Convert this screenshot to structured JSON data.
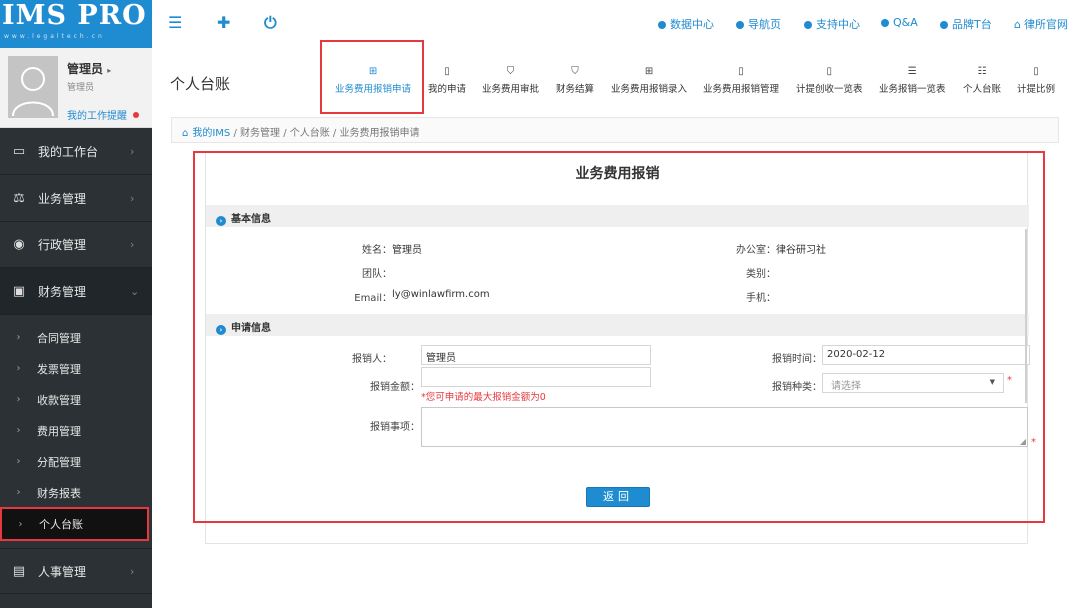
{
  "brand": {
    "logo": "IMS PRO",
    "logo_sub": "www.legaltech.cn"
  },
  "user": {
    "name": "管理员",
    "role": "管理员",
    "notice": "我的工作提醒"
  },
  "sidebar": {
    "items": [
      {
        "label": "我的工作台"
      },
      {
        "label": "业务管理"
      },
      {
        "label": "行政管理"
      },
      {
        "label": "财务管理"
      }
    ],
    "submenu": [
      {
        "label": "合同管理"
      },
      {
        "label": "发票管理"
      },
      {
        "label": "收款管理"
      },
      {
        "label": "费用管理"
      },
      {
        "label": "分配管理"
      },
      {
        "label": "财务报表"
      },
      {
        "label": "个人台账"
      }
    ],
    "bottom": {
      "label": "人事管理"
    }
  },
  "topbar": {
    "links": [
      {
        "label": "数据中心"
      },
      {
        "label": "导航页"
      },
      {
        "label": "支持中心"
      },
      {
        "label": "Q&A"
      },
      {
        "label": "品牌T台"
      },
      {
        "label": "律所官网"
      }
    ]
  },
  "page": {
    "title": "个人台账"
  },
  "toolbar": {
    "buttons": [
      {
        "label": "业务费用报销申请"
      },
      {
        "label": "我的申请"
      },
      {
        "label": "业务费用审批"
      },
      {
        "label": "财务结算"
      },
      {
        "label": "业务费用报销录入"
      },
      {
        "label": "业务费用报销管理"
      },
      {
        "label": "计提创收一览表"
      },
      {
        "label": "业务报销一览表"
      },
      {
        "label": "个人台账"
      },
      {
        "label": "计提比例"
      }
    ]
  },
  "breadcrumb": {
    "home": "我的IMS",
    "rest": " / 财务管理 / 个人台账 / 业务费用报销申请"
  },
  "form": {
    "title": "业务费用报销",
    "section1": "基本信息",
    "section2": "申请信息",
    "basic": {
      "name_label": "姓名：",
      "name": "管理员",
      "office_label": "办公室：",
      "office": "律谷研习社",
      "team_label": "团队：",
      "category_label": "类别：",
      "email_label": "Email：",
      "email": "ly@winlawfirm.com",
      "phone_label": "手机："
    },
    "apply": {
      "applicant_label": "报销人：",
      "applicant": "管理员",
      "time_label": "报销时间：",
      "time": "2020-02-12",
      "amount_label": "报销金额：",
      "amount": "",
      "amount_hint": "*您可申请的最大报销金额为0",
      "type_label": "报销种类：",
      "type_placeholder": "请选择",
      "matter_label": "报销事项：",
      "matter": "",
      "required_mark": "*"
    },
    "back_button": "返回"
  },
  "colors": {
    "accent": "#1f8bd0",
    "sidebar_bg": "#2b3135",
    "highlight": "#e5393f"
  }
}
